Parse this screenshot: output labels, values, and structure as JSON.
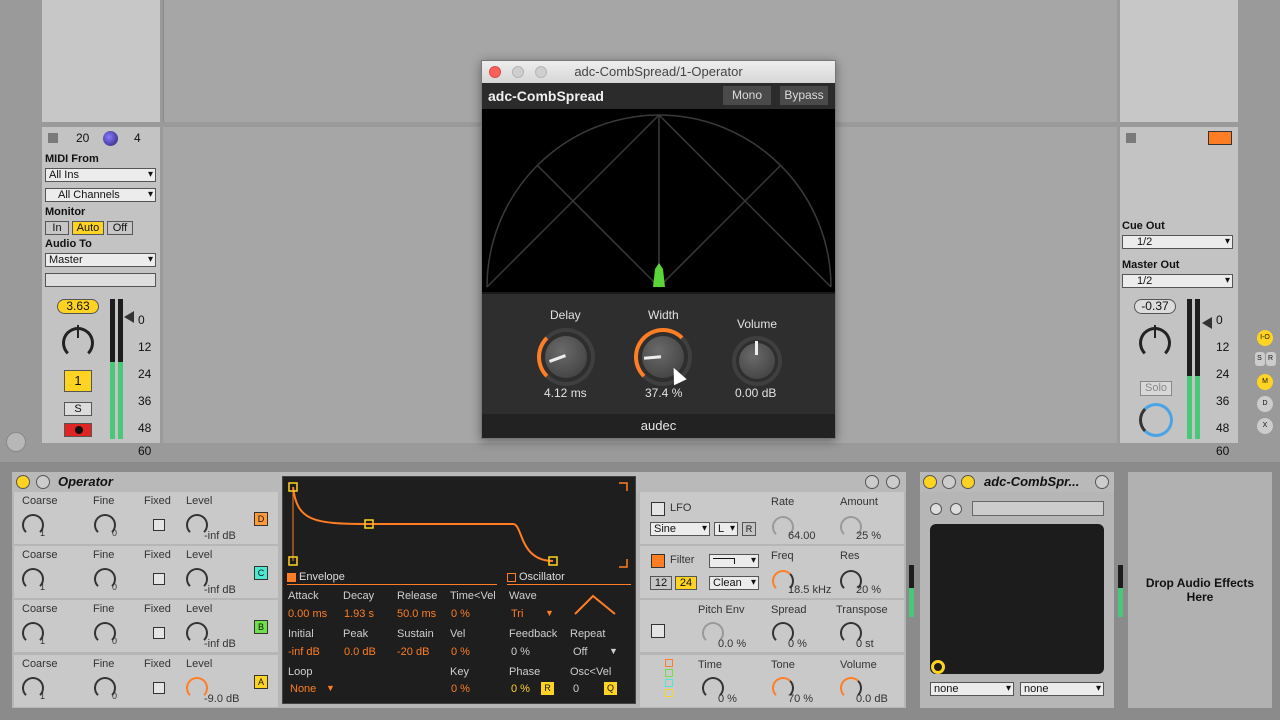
{
  "plugin": {
    "window_title": "adc-CombSpread/1-Operator",
    "name": "adc-CombSpread",
    "mono": "Mono",
    "bypass": "Bypass",
    "brand": "audec",
    "knobs": [
      {
        "label": "Delay",
        "value": "4.12 ms"
      },
      {
        "label": "Width",
        "value": "37.4 %"
      },
      {
        "label": "Volume",
        "value": "0.00 dB"
      }
    ]
  },
  "track": {
    "n1": "20",
    "n2": "4",
    "midi_from": "MIDI From",
    "midi_from_value": "All Ins",
    "channels": "All Channels",
    "monitor": "Monitor",
    "mon_in": "In",
    "mon_auto": "Auto",
    "mon_off": "Off",
    "audio_to": "Audio To",
    "audio_to_value": "Master",
    "volume": "3.63",
    "number": "1",
    "solo": "S",
    "scale": [
      "0",
      "12",
      "24",
      "36",
      "48",
      "60"
    ]
  },
  "master": {
    "cue_out": "Cue Out",
    "cue_value": "1/2",
    "master_out": "Master Out",
    "master_value": "1/2",
    "volume": "-0.37",
    "solo": "Solo",
    "scale": [
      "0",
      "12",
      "24",
      "36",
      "48",
      "60"
    ],
    "side": [
      "I-O",
      "S",
      "R",
      "M",
      "D",
      "X"
    ]
  },
  "operator": {
    "title": "Operator",
    "rows": [
      {
        "coarse": "Coarse",
        "fine": "Fine",
        "fixed": "Fixed",
        "level": "Level",
        "c": "1",
        "f": "0",
        "lv": "-inf dB",
        "osc": "D"
      },
      {
        "coarse": "Coarse",
        "fine": "Fine",
        "fixed": "Fixed",
        "level": "Level",
        "c": "1",
        "f": "0",
        "lv": "-inf dB",
        "osc": "C"
      },
      {
        "coarse": "Coarse",
        "fine": "Fine",
        "fixed": "Fixed",
        "level": "Level",
        "c": "1",
        "f": "0",
        "lv": "-inf dB",
        "osc": "B"
      },
      {
        "coarse": "Coarse",
        "fine": "Fine",
        "fixed": "Fixed",
        "level": "Level",
        "c": "1",
        "f": "0",
        "lv": "-9.0 dB",
        "osc": "A"
      }
    ],
    "env": {
      "tab": "Envelope",
      "osc_tab": "Oscillator",
      "attack": "Attack",
      "decay": "Decay",
      "release": "Release",
      "timevel": "Time<Vel",
      "a": "0.00 ms",
      "d": "1.93 s",
      "r": "50.0 ms",
      "tv": "0 %",
      "initial": "Initial",
      "peak": "Peak",
      "sustain": "Sustain",
      "vel": "Vel",
      "i": "-inf dB",
      "p": "0.0 dB",
      "s": "-20 dB",
      "v": "0 %",
      "loop": "Loop",
      "loop_v": "None",
      "key": "Key",
      "key_v": "0 %",
      "wave": "Wave",
      "wave_v": "Tri",
      "feedback": "Feedback",
      "feedback_v": "0 %",
      "repeat": "Repeat",
      "repeat_v": "Off",
      "phase": "Phase",
      "phase_v": "0 %",
      "r_badge": "R",
      "oscvel": "Osc<Vel",
      "oscvel_v": "0",
      "q_badge": "Q"
    },
    "lfo": {
      "label": "LFO",
      "rate": "Rate",
      "rate_v": "64.00",
      "amount": "Amount",
      "amount_v": "25 %",
      "wave": "Sine",
      "l": "L",
      "r": "R"
    },
    "filter": {
      "label": "Filter",
      "freq": "Freq",
      "freq_v": "18.5 kHz",
      "res": "Res",
      "res_v": "20 %",
      "n12": "12",
      "n24": "24",
      "clean": "Clean"
    },
    "pitch": {
      "label": "Pitch Env",
      "pv": "0.0 %",
      "spread": "Spread",
      "spread_v": "0 %",
      "transpose": "Transpose",
      "transpose_v": "0 st"
    },
    "global": {
      "time": "Time",
      "time_v": "0 %",
      "tone": "Tone",
      "tone_v": "70 %",
      "volume": "Volume",
      "volume_v": "0.0 dB"
    }
  },
  "rack": {
    "title": "adc-CombSpr...",
    "sel1": "none",
    "sel2": "none"
  },
  "drop": {
    "text": "Drop Audio Effects Here"
  },
  "colors": {
    "accent": "#ff7d24",
    "green": "#49c87a",
    "yellow": "#ffd321"
  }
}
